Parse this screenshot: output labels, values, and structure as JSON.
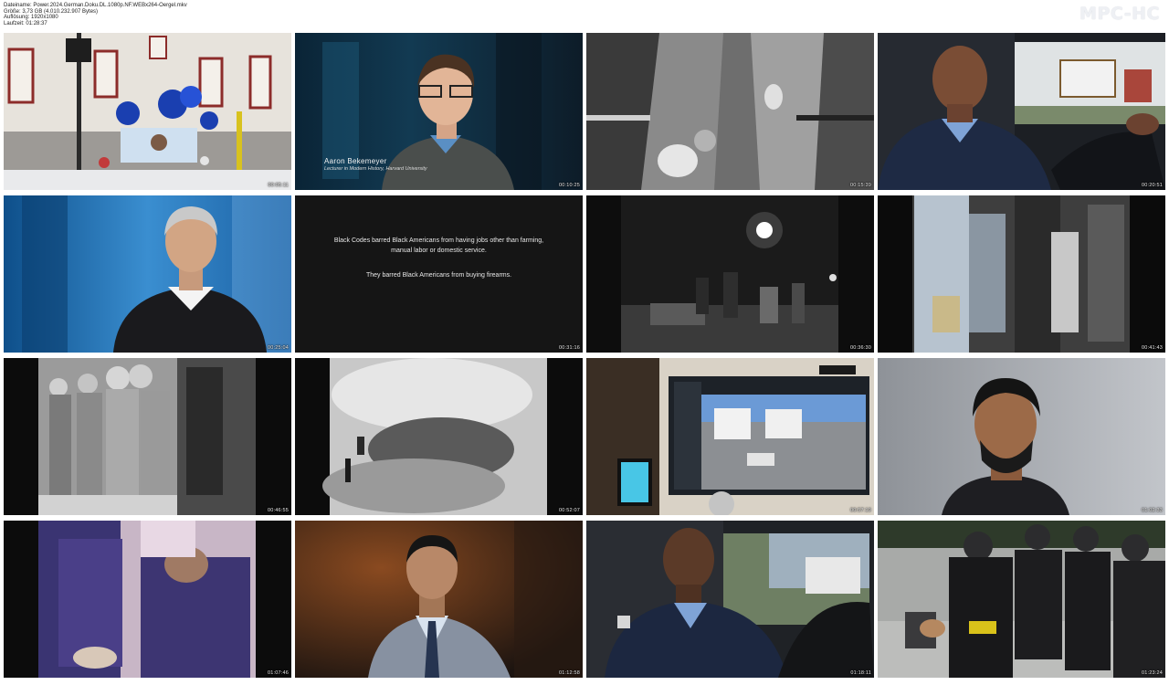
{
  "app": {
    "brand": "MPC-HC"
  },
  "file_info": {
    "line1": "Dateiname: Power.2024.German.Doku.DL.1080p.NF.WEBx264-Oergel.mkv",
    "line2": "Größe: 3,73 GB (4.010.232.907 Bytes)",
    "line3": "Auflösung: 1920x1080",
    "line4": "Laufzeit: 01:28:37"
  },
  "thumbnails": [
    {
      "timestamp": "00:05:11",
      "scene": "memorial-street-corner"
    },
    {
      "timestamp": "00:10:25",
      "scene": "interview-aaron",
      "lower_third": {
        "name": "Aaron Bekemeyer",
        "role": "Lecturer in Modern History, Harvard University"
      }
    },
    {
      "timestamp": "00:15:39",
      "scene": "arrest-handcuffs"
    },
    {
      "timestamp": "00:20:51",
      "scene": "officer-driving"
    },
    {
      "timestamp": "00:25:04",
      "scene": "interview-grey-hair"
    },
    {
      "timestamp": "00:31:16",
      "scene": "text-card",
      "caption": {
        "line1": "Black Codes barred Black Americans from having jobs other than farming,",
        "line2": "manual labor or domestic service.",
        "line3": "They barred Black Americans from buying firearms."
      }
    },
    {
      "timestamp": "00:36:30",
      "scene": "night-street-archive"
    },
    {
      "timestamp": "00:41:43",
      "scene": "blurred-archive"
    },
    {
      "timestamp": "00:46:55",
      "scene": "soldiers-archive"
    },
    {
      "timestamp": "00:52:07",
      "scene": "smoke-archive"
    },
    {
      "timestamp": "00:57:19",
      "scene": "monitor-street-view"
    },
    {
      "timestamp": "01:02:33",
      "scene": "interview-dark-hair"
    },
    {
      "timestamp": "01:07:46",
      "scene": "purple-archive"
    },
    {
      "timestamp": "01:12:58",
      "scene": "interview-suit"
    },
    {
      "timestamp": "01:18:11",
      "scene": "officer-driving-2"
    },
    {
      "timestamp": "01:23:24",
      "scene": "riot-police"
    }
  ]
}
